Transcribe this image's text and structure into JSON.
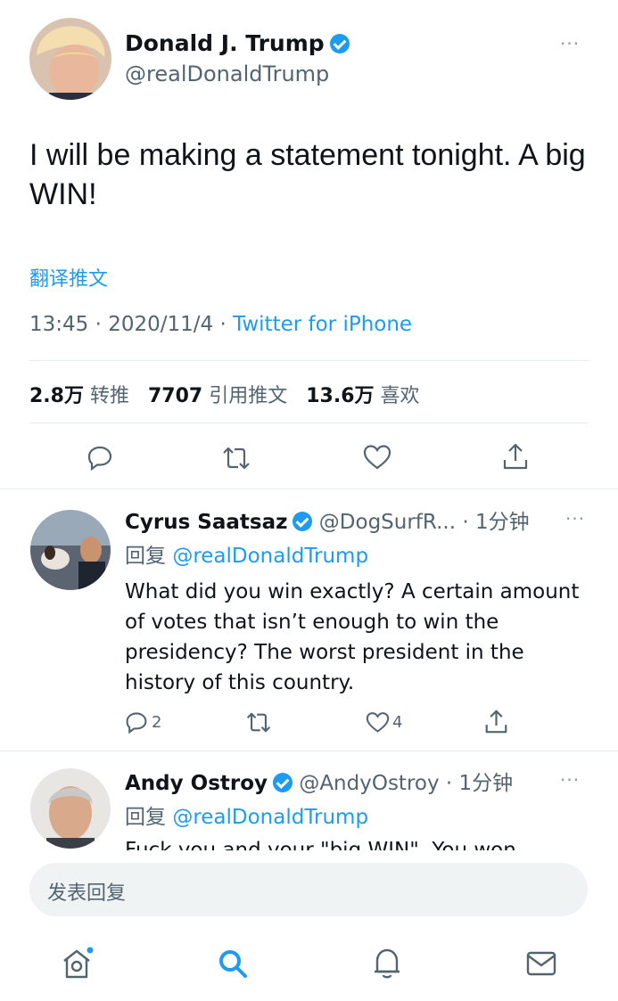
{
  "tweet": {
    "author_name": "Donald J. Trump",
    "author_handle": "@realDonaldTrump",
    "text": "I will be making a statement tonight. A big WIN!",
    "translate_label": "翻译推文",
    "time": "13:45",
    "date": "2020/11/4",
    "source": "Twitter for iPhone",
    "separator": "·",
    "stats": {
      "retweets_value": "2.8万",
      "retweets_label": "转推",
      "quotes_value": "7707",
      "quotes_label": "引用推文",
      "likes_value": "13.6万",
      "likes_label": "喜欢"
    }
  },
  "replies": [
    {
      "name": "Cyrus Saatsaz",
      "handle": "@DogSurfR...",
      "time": "· 1分钟",
      "reply_prefix": "回复",
      "reply_to": "@realDonaldTrump",
      "text": "What did you win exactly? A certain amount of votes that isn’t enough to win the presidency? The worst president in the history of this country.",
      "reply_count": "2",
      "like_count": "4"
    },
    {
      "name": "Andy Ostroy",
      "handle": "@AndyOstroy",
      "time": "· 1分钟",
      "reply_prefix": "回复",
      "reply_to": "@realDonaldTrump",
      "text": "Fuck you and your \"big WIN\". You won"
    }
  ],
  "composer": {
    "placeholder": "发表回复"
  },
  "more_label": "···",
  "colors": {
    "accent": "#1d9bf0",
    "verified": "#1d9bf0",
    "text": "#0f1419",
    "secondary": "#536471"
  },
  "icons": {
    "action_bar": [
      "reply-icon",
      "retweet-icon",
      "like-icon",
      "share-icon"
    ],
    "bottom_nav": [
      "home-icon",
      "search-icon",
      "notifications-icon",
      "messages-icon"
    ]
  }
}
